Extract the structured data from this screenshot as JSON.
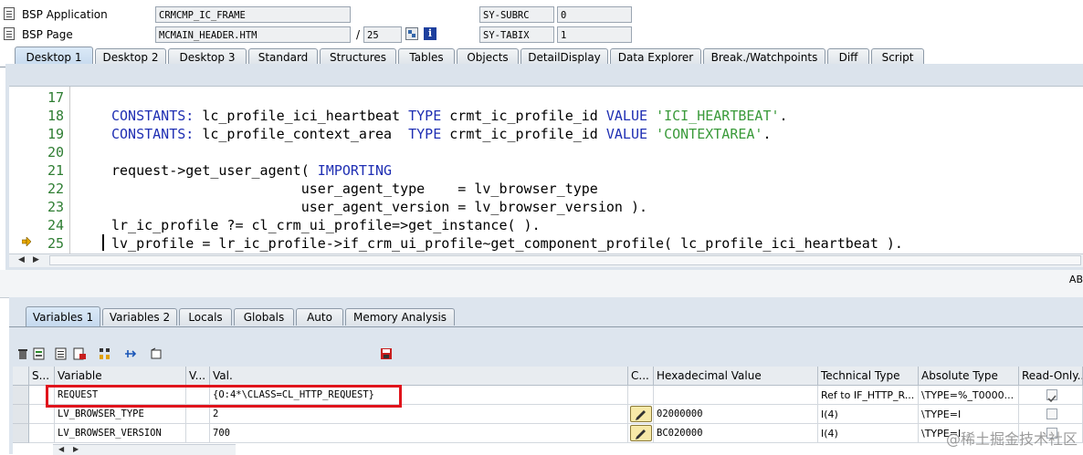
{
  "header": {
    "bsp_app_label": "BSP Application",
    "bsp_app_value": "CRMCMP_IC_FRAME",
    "bsp_page_label": "BSP Page",
    "bsp_page_value": "MCMAIN_HEADER.HTM",
    "page_sep": "/",
    "page_count": "25",
    "subrc_label": "SY-SUBRC",
    "subrc_value": "0",
    "tabix_label": "SY-TABIX",
    "tabix_value": "1"
  },
  "top_tabs": [
    "Desktop 1",
    "Desktop 2",
    "Desktop 3",
    "Standard",
    "Structures",
    "Tables",
    "Objects",
    "DetailDisplay",
    "Data Explorer",
    "Break./Watchpoints",
    "Diff",
    "Script"
  ],
  "code": [
    {
      "n": "17",
      "parts": []
    },
    {
      "n": "18",
      "parts": [
        [
          "kw",
          "CONSTANTS: "
        ],
        [
          "t",
          "lc_profile_ici_heartbeat "
        ],
        [
          "kw",
          "TYPE "
        ],
        [
          "t",
          "crmt_ic_profile_id "
        ],
        [
          "kw",
          "VALUE "
        ],
        [
          "str",
          "'ICI_HEARTBEAT'"
        ],
        [
          "t",
          "."
        ]
      ]
    },
    {
      "n": "19",
      "parts": [
        [
          "kw",
          "CONSTANTS: "
        ],
        [
          "t",
          "lc_profile_context_area  "
        ],
        [
          "kw",
          "TYPE "
        ],
        [
          "t",
          "crmt_ic_profile_id "
        ],
        [
          "kw",
          "VALUE "
        ],
        [
          "str",
          "'CONTEXTAREA'"
        ],
        [
          "t",
          "."
        ]
      ]
    },
    {
      "n": "20",
      "parts": []
    },
    {
      "n": "21",
      "parts": [
        [
          "t",
          "request->get_user_agent( "
        ],
        [
          "kw",
          "IMPORTING"
        ]
      ]
    },
    {
      "n": "22",
      "parts": [
        [
          "t",
          "                       user_agent_type    = lv_browser_type"
        ]
      ]
    },
    {
      "n": "23",
      "parts": [
        [
          "t",
          "                       user_agent_version = lv_browser_version )."
        ]
      ]
    },
    {
      "n": "24",
      "parts": [
        [
          "t",
          "lr_ic_profile ?= cl_crm_ui_profile=>get_instance( )."
        ]
      ]
    },
    {
      "n": "25",
      "parts": [
        [
          "t",
          "lv_profile = lr_ic_profile->if_crm_ui_profile~get_component_profile( lc_profile_ici_heartbeat )."
        ]
      ]
    }
  ],
  "band_right_text": "AB",
  "var_tabs": [
    "Variables 1",
    "Variables 2",
    "Locals",
    "Globals",
    "Auto",
    "Memory Analysis"
  ],
  "grid": {
    "headers": [
      "S...",
      "Variable",
      "V...",
      "Val.",
      "C...",
      "Hexadecimal Value",
      "Technical Type",
      "Absolute Type",
      "Read-Only..."
    ],
    "rows": [
      {
        "variable": "REQUEST",
        "val": "{O:4*\\CLASS=CL_HTTP_REQUEST}",
        "hex": "",
        "tech": "Ref to IF_HTTP_R...",
        "abs": "\\TYPE=%_T0000...",
        "readonly": true,
        "editable": false
      },
      {
        "variable": "LV_BROWSER_TYPE",
        "val": "2",
        "hex": "02000000",
        "tech": "I(4)",
        "abs": "\\TYPE=I",
        "readonly": false,
        "editable": true
      },
      {
        "variable": "LV_BROWSER_VERSION",
        "val": "700",
        "hex": "BC020000",
        "tech": "I(4)",
        "abs": "\\TYPE=I",
        "readonly": false,
        "editable": true
      }
    ]
  },
  "watermark": "@稀土掘金技术社区"
}
